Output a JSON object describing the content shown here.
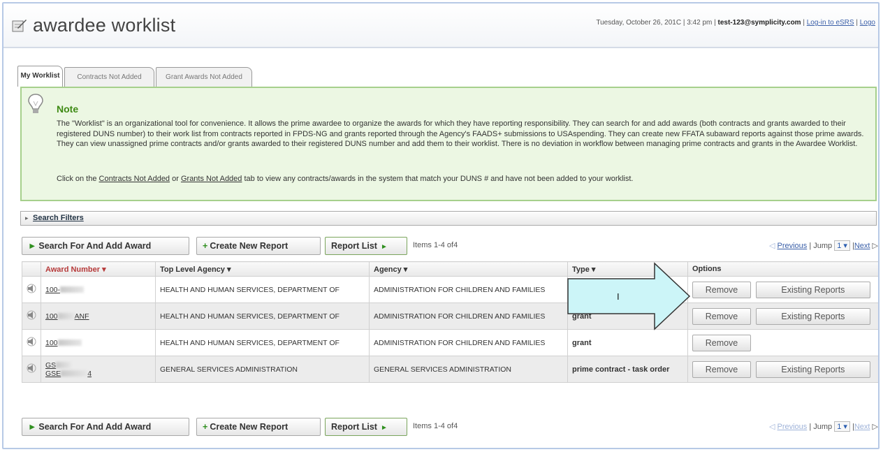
{
  "header": {
    "title": "awardee worklist",
    "date_text": "Tuesday, October 26, 201C | 3:42 pm |",
    "user": "test-123@symplicity.com",
    "sep": "|",
    "login_link": "Log-in to eSRS",
    "logout_link": "Logo"
  },
  "tabs": [
    {
      "label": "My Worklist"
    },
    {
      "label": "Contracts Not Added"
    },
    {
      "label": "Grant Awards Not Added"
    }
  ],
  "note": {
    "title": "Note",
    "body": "The \"Worklist\" is an organizational tool for convenience. It allows the prime awardee to organize the awards for which they have reporting responsibility. They can search for and add awards (both contracts and grants awarded to their registered DUNS number) to their work list from contracts reported in FPDS-NG and grants reported through the Agency's FAADS+ submissions to USAspending. They can create new FFATA subaward reports against those prime awards. They can view unassigned prime contracts and/or grants awarded to their registered DUNS number and add them to their worklist. There is no deviation in workflow between managing prime contracts and grants in the Awardee Worklist.",
    "click_prefix": "Click on the",
    "contracts_link": "Contracts Not Added",
    "or_text": "or",
    "grants_link": "Grants Not Added",
    "click_suffix": "tab to view any contracts/awards in the system that match your DUNS # and have not been added to your worklist."
  },
  "filters": {
    "label": "Search Filters"
  },
  "toolbar": {
    "search_add": "Search For And Add Award",
    "create_report": "Create New Report",
    "report_list": "Report List",
    "items": "Items 1-4 of4",
    "previous": "Previous",
    "jump": "| Jump",
    "page": "1",
    "next": "Next"
  },
  "table": {
    "headers": [
      "Award Number ▾",
      "Top Level Agency ▾",
      "Agency ▾",
      "Type ▾",
      "Options"
    ],
    "rows": [
      {
        "award_prefix": "100-",
        "award_suffix": "",
        "top_agency": "HEALTH AND HUMAN SERVICES, DEPARTMENT OF",
        "agency": "ADMINISTRATION FOR CHILDREN AND FAMILIES",
        "type": "",
        "options": [
          "Remove",
          "Existing Reports"
        ]
      },
      {
        "award_prefix": "100",
        "award_suffix": "ANF",
        "top_agency": "HEALTH AND HUMAN SERVICES, DEPARTMENT OF",
        "agency": "ADMINISTRATION FOR CHILDREN AND FAMILIES",
        "type": "grant",
        "options": [
          "Remove",
          "Existing Reports"
        ]
      },
      {
        "award_prefix": "100",
        "award_suffix": "",
        "top_agency": "HEALTH AND HUMAN SERVICES, DEPARTMENT OF",
        "agency": "ADMINISTRATION FOR CHILDREN AND FAMILIES",
        "type": "grant",
        "options": [
          "Remove"
        ]
      },
      {
        "award_prefix": "GS",
        "award_line2": "GSE",
        "award_suffix": "4",
        "top_agency": "GENERAL SERVICES ADMINISTRATION",
        "agency": "GENERAL SERVICES ADMINISTRATION",
        "type": "prime contract - task order",
        "options": [
          "Remove",
          "Existing Reports"
        ]
      }
    ]
  },
  "callout": {
    "text": "I",
    "fill": "#ccf5f8",
    "stroke": "#333333"
  }
}
